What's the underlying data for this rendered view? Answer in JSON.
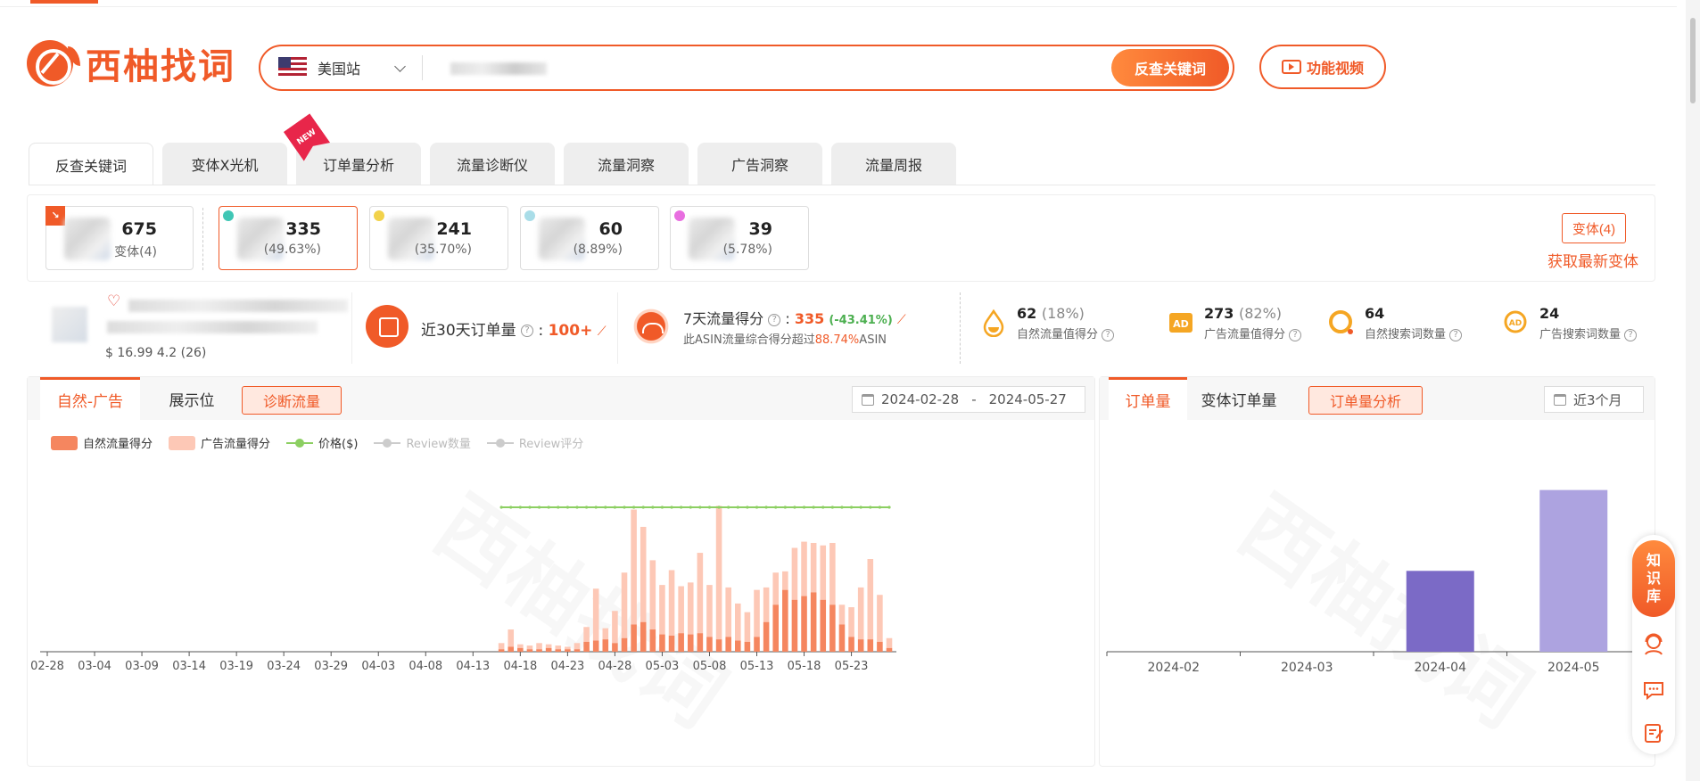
{
  "brand": {
    "logo_text": "西柚找词"
  },
  "search": {
    "site": "美国站",
    "placeholder": "",
    "button": "反查关键词"
  },
  "video_button": "功能视频",
  "tabs": [
    "反查关键词",
    "变体X光机",
    "订单量分析",
    "流量诊断仪",
    "流量洞察",
    "广告洞察",
    "流量周报"
  ],
  "new_badge": "NEW",
  "variants": [
    {
      "value": "675",
      "sub": "变体(4)"
    },
    {
      "value": "335",
      "sub": "(49.63%)"
    },
    {
      "value": "241",
      "sub": "(35.70%)"
    },
    {
      "value": "60",
      "sub": "(8.89%)"
    },
    {
      "value": "39",
      "sub": "(5.78%)"
    }
  ],
  "variant_button": "变体(4)",
  "refresh_link": "获取最新变体",
  "product": {
    "price_line": "$ 16.99 4.2 (26)"
  },
  "orders30": {
    "label": "近30天订单量",
    "value": "100+"
  },
  "traffic7": {
    "label": "7天流量得分",
    "value": "335",
    "change": "(-43.41%)",
    "sub_prefix": "此ASIN流量综合得分超过",
    "sub_pct": "88.74%",
    "sub_suffix": "ASIN"
  },
  "stats": [
    {
      "value": "62",
      "pct": "(18%)",
      "label": "自然流量值得分",
      "icon": "drop-icon"
    },
    {
      "value": "273",
      "pct": "(82%)",
      "label": "广告流量值得分",
      "icon": "ad-icon"
    },
    {
      "value": "64",
      "pct": "",
      "label": "自然搜索词数量",
      "icon": "search-icon"
    },
    {
      "value": "24",
      "pct": "",
      "label": "广告搜索词数量",
      "icon": "ad-search-icon"
    }
  ],
  "left_panel": {
    "tabs": [
      "自然-广告",
      "展示位"
    ],
    "button": "诊断流量",
    "date_start": "2024-02-28",
    "date_sep": "-",
    "date_end": "2024-05-27",
    "legend": [
      "自然流量得分",
      "广告流量得分",
      "价格($)",
      "Review数量",
      "Review评分"
    ]
  },
  "right_panel": {
    "tabs": [
      "订单量",
      "变体订单量"
    ],
    "button": "订单量分析",
    "range": "近3个月"
  },
  "floating": {
    "knowledge": [
      "知",
      "识",
      "库"
    ]
  },
  "watermark": "西柚找词",
  "colors": {
    "accent": "#f05a28",
    "natural": "#f5865f",
    "ad": "#fdc8b6",
    "price": "#8ccf62",
    "bar_dark": "#7b6ac6",
    "bar_light": "#ada3e0"
  },
  "chart_data": [
    {
      "type": "bar",
      "title": "",
      "x": [
        "02-28",
        "02-29",
        "03-01",
        "03-02",
        "03-03",
        "03-04",
        "03-05",
        "03-06",
        "03-07",
        "03-08",
        "03-09",
        "03-10",
        "03-11",
        "03-12",
        "03-13",
        "03-14",
        "03-15",
        "03-16",
        "03-17",
        "03-18",
        "03-19",
        "03-20",
        "03-21",
        "03-22",
        "03-23",
        "03-24",
        "03-25",
        "03-26",
        "03-27",
        "03-28",
        "03-29",
        "03-30",
        "03-31",
        "04-01",
        "04-02",
        "04-03",
        "04-04",
        "04-05",
        "04-06",
        "04-07",
        "04-08",
        "04-09",
        "04-10",
        "04-11",
        "04-12",
        "04-13",
        "04-14",
        "04-15",
        "04-16",
        "04-17",
        "04-18",
        "04-19",
        "04-20",
        "04-21",
        "04-22",
        "04-23",
        "04-24",
        "04-25",
        "04-26",
        "04-27",
        "04-28",
        "04-29",
        "04-30",
        "05-01",
        "05-02",
        "05-03",
        "05-04",
        "05-05",
        "05-06",
        "05-07",
        "05-08",
        "05-09",
        "05-10",
        "05-11",
        "05-12",
        "05-13",
        "05-14",
        "05-15",
        "05-16",
        "05-17",
        "05-18",
        "05-19",
        "05-20",
        "05-21",
        "05-22",
        "05-23",
        "05-24",
        "05-25",
        "05-26",
        "05-27"
      ],
      "xticks": [
        "02-28",
        "03-04",
        "03-09",
        "03-14",
        "03-19",
        "03-24",
        "03-29",
        "04-03",
        "04-08",
        "04-13",
        "04-18",
        "04-23",
        "04-28",
        "05-03",
        "05-08",
        "05-13",
        "05-18",
        "05-23"
      ],
      "series": [
        {
          "name": "自然流量得分",
          "stack": "s",
          "values": [
            0,
            0,
            0,
            0,
            0,
            0,
            0,
            0,
            0,
            0,
            0,
            0,
            0,
            0,
            0,
            0,
            0,
            0,
            0,
            0,
            0,
            0,
            0,
            0,
            0,
            0,
            0,
            0,
            0,
            0,
            0,
            0,
            0,
            0,
            0,
            0,
            0,
            0,
            0,
            0,
            0,
            0,
            0,
            0,
            0,
            0,
            0,
            0,
            2,
            4,
            3,
            2,
            2,
            3,
            2,
            2,
            2,
            8,
            9,
            10,
            7,
            11,
            22,
            24,
            18,
            14,
            13,
            15,
            14,
            15,
            12,
            10,
            12,
            9,
            8,
            12,
            24,
            38,
            50,
            42,
            45,
            48,
            42,
            38,
            22,
            12,
            10,
            10,
            8,
            3
          ]
        },
        {
          "name": "广告流量得分",
          "stack": "s",
          "values": [
            0,
            0,
            0,
            0,
            0,
            0,
            0,
            0,
            0,
            0,
            0,
            0,
            0,
            0,
            0,
            0,
            0,
            0,
            0,
            0,
            0,
            0,
            0,
            0,
            0,
            0,
            0,
            0,
            0,
            0,
            0,
            0,
            0,
            0,
            0,
            0,
            0,
            0,
            0,
            0,
            0,
            0,
            0,
            0,
            0,
            0,
            0,
            0,
            5,
            14,
            3,
            3,
            5,
            3,
            3,
            2,
            5,
            12,
            42,
            9,
            26,
            53,
            93,
            77,
            56,
            40,
            53,
            38,
            42,
            65,
            42,
            108,
            40,
            30,
            24,
            38,
            28,
            26,
            15,
            42,
            44,
            40,
            44,
            50,
            16,
            24,
            42,
            65,
            38,
            8
          ]
        },
        {
          "name": "价格($)",
          "type": "line",
          "values": [
            null,
            null,
            null,
            null,
            null,
            null,
            null,
            null,
            null,
            null,
            null,
            null,
            null,
            null,
            null,
            null,
            null,
            null,
            null,
            null,
            null,
            null,
            null,
            null,
            null,
            null,
            null,
            null,
            null,
            null,
            null,
            null,
            null,
            null,
            null,
            null,
            null,
            null,
            null,
            null,
            null,
            null,
            null,
            null,
            null,
            null,
            null,
            null,
            16.99,
            16.99,
            16.99,
            16.99,
            16.99,
            16.99,
            16.99,
            16.99,
            16.99,
            16.99,
            16.99,
            16.99,
            16.99,
            16.99,
            16.99,
            16.99,
            16.99,
            16.99,
            16.99,
            16.99,
            16.99,
            16.99,
            16.99,
            16.99,
            16.99,
            16.99,
            16.99,
            16.99,
            16.99,
            16.99,
            16.99,
            16.99,
            16.99,
            16.99,
            16.99,
            16.99,
            16.99,
            16.99,
            16.99,
            16.99,
            16.99,
            16.99
          ]
        }
      ],
      "ylim": [
        0,
        150
      ]
    },
    {
      "type": "bar",
      "title": "",
      "categories": [
        "2024-02",
        "2024-03",
        "2024-04",
        "2024-05"
      ],
      "values": [
        0,
        0,
        109,
        218
      ],
      "ylim": [
        0,
        250
      ]
    }
  ]
}
